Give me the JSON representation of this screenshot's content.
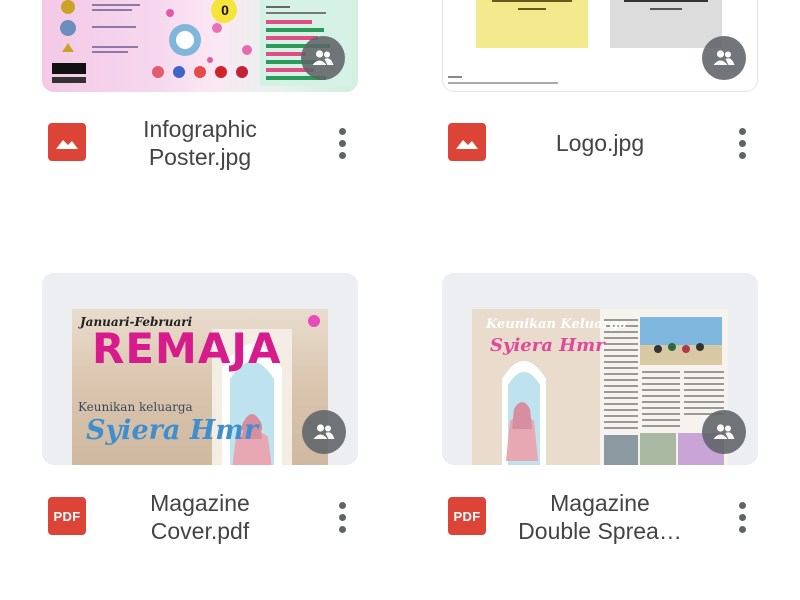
{
  "files": [
    {
      "name_line1": "Infographic",
      "name_line2": "Poster.jpg",
      "type": "image",
      "type_icon": "image-icon",
      "shared_icon": "people-icon",
      "more_icon": "more-vert-icon",
      "preview_text": "0"
    },
    {
      "name_line1": "Logo.jpg",
      "name_line2": "",
      "type": "image",
      "type_icon": "image-icon",
      "shared_icon": "people-icon",
      "more_icon": "more-vert-icon"
    },
    {
      "name_line1": "Magazine",
      "name_line2": "Cover.pdf",
      "type": "pdf",
      "type_label": "PDF",
      "type_icon": "pdf-icon",
      "shared_icon": "people-icon",
      "more_icon": "more-vert-icon",
      "preview_date": "Januari-Februari",
      "preview_title": "REMAJA",
      "preview_subtitle": "Keunikan keluarga",
      "preview_name": "Syiera Hmr"
    },
    {
      "name_line1": "Magazine",
      "name_line2": "Double Sprea…",
      "type": "pdf",
      "type_label": "PDF",
      "type_icon": "pdf-icon",
      "shared_icon": "people-icon",
      "more_icon": "more-vert-icon",
      "preview_title": "Keunikan Keluarga",
      "preview_name": "Syiera Hmr"
    }
  ],
  "colors": {
    "pdf_red": "#db4437",
    "magenta": "#d81b8c",
    "icon_grey": "#5f6368",
    "thumb_bg": "#eceef1"
  }
}
